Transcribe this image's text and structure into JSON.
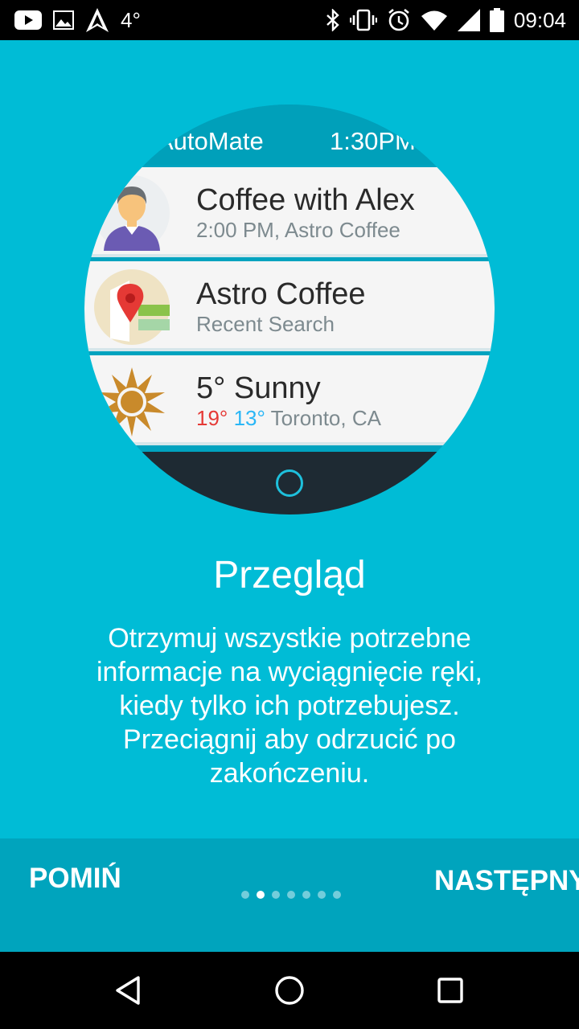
{
  "status_bar": {
    "temperature": "4°",
    "time": "09:04",
    "icons": [
      "youtube-icon",
      "image-icon",
      "arrow-app-icon",
      "bluetooth-icon",
      "vibrate-icon",
      "alarm-icon",
      "wifi-icon",
      "signal-icon",
      "battery-icon"
    ]
  },
  "watch": {
    "app_title": "AutoMate",
    "time": "1:30PM",
    "cards": [
      {
        "title": "Coffee with Alex",
        "subtitle": "2:00 PM, Astro Coffee",
        "icon": "person-avatar-icon"
      },
      {
        "title": "Astro Coffee",
        "subtitle": "Recent Search",
        "icon": "map-pin-icon"
      },
      {
        "title": "5° Sunny",
        "temp_high": "19°",
        "temp_low": "13°",
        "location": "Toronto, CA",
        "icon": "sun-icon"
      }
    ],
    "colors": {
      "header": "#00a0ba",
      "footer": "#1e2a33",
      "temp_high": "#e53935",
      "temp_low": "#29b6f6"
    }
  },
  "onboarding": {
    "title": "Przegląd",
    "description": "Otrzymuj wszystkie potrzebne informacje na wyciągnięcie ręki, kiedy tylko ich potrzebujesz. Przeciągnij aby odrzucić po zakończeniu."
  },
  "bottom_bar": {
    "skip_label": "POMIŃ",
    "next_label": "NASTĘPNY",
    "page_count": 7,
    "current_page": 2
  },
  "nav": {
    "icons": [
      "back-icon",
      "home-icon",
      "recents-icon"
    ]
  },
  "colors": {
    "background": "#00bcd6",
    "bottom_bar": "#00a4bd"
  }
}
